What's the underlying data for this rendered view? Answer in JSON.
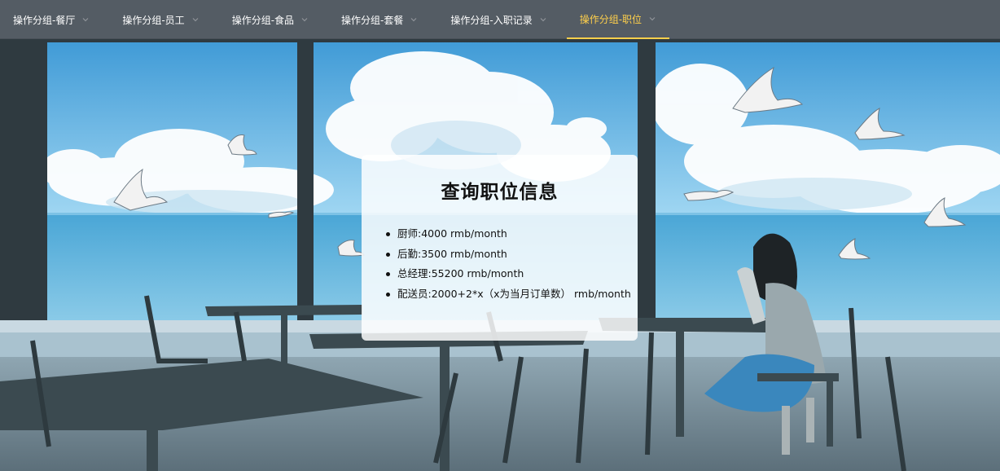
{
  "nav": {
    "items": [
      {
        "label": "操作分组-餐厅",
        "active": false
      },
      {
        "label": "操作分组-员工",
        "active": false
      },
      {
        "label": "操作分组-食品",
        "active": false
      },
      {
        "label": "操作分组-套餐",
        "active": false
      },
      {
        "label": "操作分组-入职记录",
        "active": false
      },
      {
        "label": "操作分组-职位",
        "active": true
      }
    ],
    "background_color": "#545c64",
    "text_color": "#ffffff",
    "active_color": "#ffd04b",
    "dropdown_icon": "chevron-down-icon"
  },
  "card": {
    "title": "查询职位信息",
    "positions": [
      "厨师:4000 rmb/month",
      "后勤:3500 rmb/month",
      "总经理:55200 rmb/month",
      "配送员:2000+2*x（x为当月订单数） rmb/month"
    ]
  },
  "background": {
    "description_icon": "anime-cafe-ocean-illustration",
    "sky_color": "#5fb6e4",
    "sea_color": "#3f9fd0"
  }
}
